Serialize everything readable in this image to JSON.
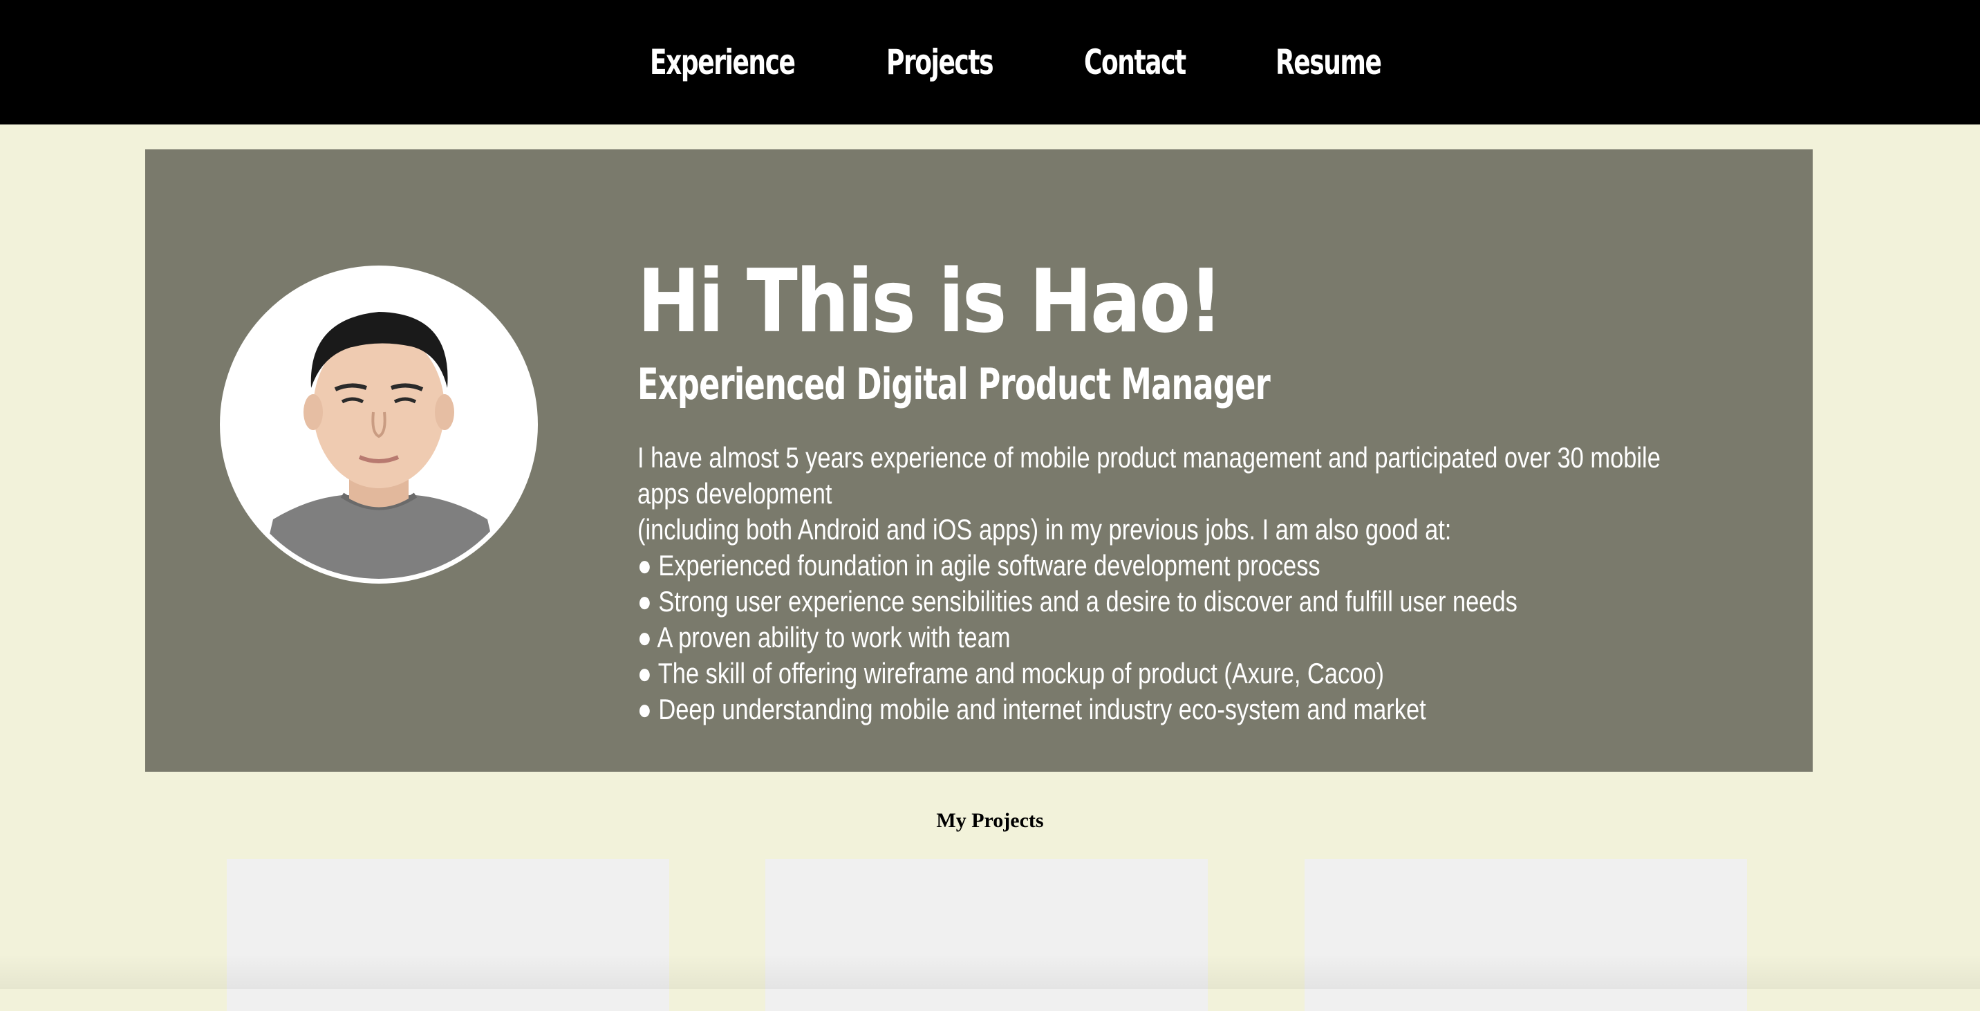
{
  "nav": {
    "items": [
      {
        "label": "Experience"
      },
      {
        "label": "Projects"
      },
      {
        "label": "Contact"
      },
      {
        "label": "Resume"
      }
    ]
  },
  "hero": {
    "title": "Hi This is Hao!",
    "subtitle": "Experienced Digital Product Manager",
    "lines": [
      "I have almost 5 years experience of mobile product management and participated over 30 mobile",
      "apps development",
      "(including both Android and iOS apps) in my previous jobs. I am also good at:",
      "● Experienced foundation in agile software development process",
      "● Strong user experience sensibilities and a desire to discover and fulfill user needs",
      "● A proven ability to work with team",
      "● The skill of offering wireframe and mockup of product (Axure, Cacoo)",
      "● Deep understanding mobile and internet industry eco-system and market"
    ]
  },
  "projects": {
    "title": "My Projects"
  },
  "colors": {
    "nav_bg": "#000000",
    "page_bg": "#f2f2da",
    "hero_bg": "#7a7a6c",
    "card_bg": "#f0f0f0"
  }
}
